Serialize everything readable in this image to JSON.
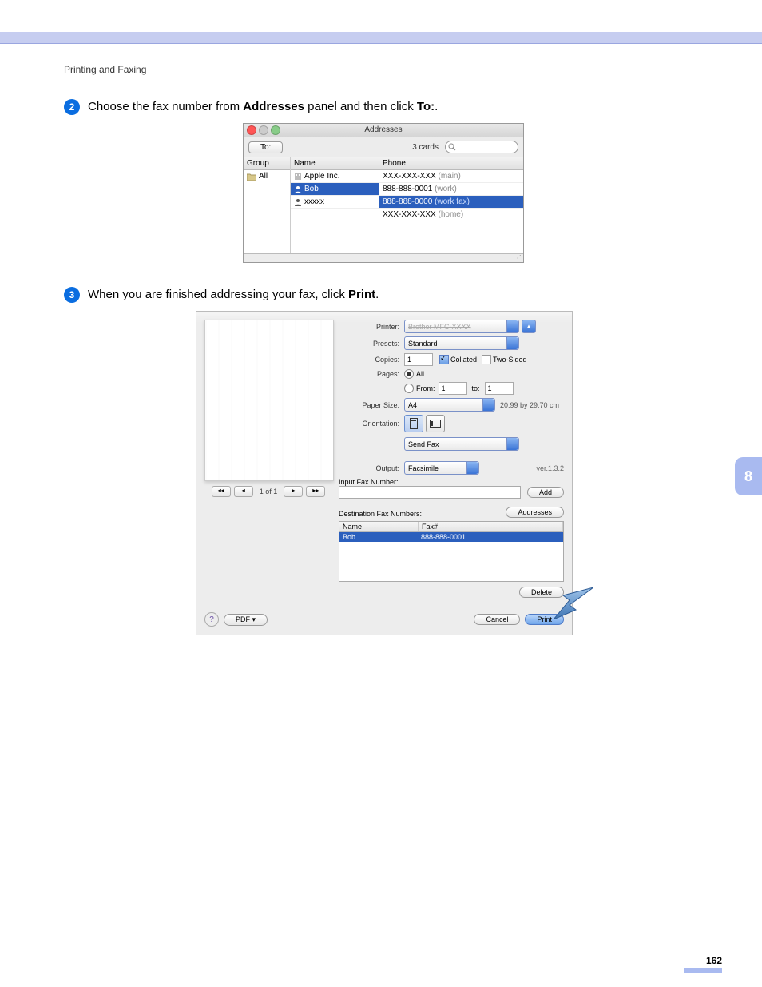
{
  "doc": {
    "header": "Printing and Faxing",
    "chapter_tab": "8",
    "page_number": "162"
  },
  "steps": {
    "s2": {
      "num": "2",
      "pre": "Choose the fax number from ",
      "b1": "Addresses",
      "mid": " panel and then click ",
      "b2": "To:",
      "post": "."
    },
    "s3": {
      "num": "3",
      "pre": "When you are finished addressing your fax, click ",
      "b1": "Print",
      "post": "."
    }
  },
  "addresses_panel": {
    "title": "Addresses",
    "to_button": "To:",
    "card_count": "3 cards",
    "search_placeholder": "",
    "columns": {
      "group": "Group",
      "name": "Name",
      "phone": "Phone"
    },
    "group_items": [
      "All"
    ],
    "contacts": [
      {
        "name": "Apple Inc.",
        "phones": [
          {
            "number": "XXX-XXX-XXX",
            "label": "(main)",
            "selected": false
          }
        ]
      },
      {
        "name": "Bob",
        "selected": true,
        "phones": [
          {
            "number": "888-888-0001",
            "label": "(work)",
            "selected": false
          },
          {
            "number": "888-888-0000",
            "label": "(work fax)",
            "selected": true
          }
        ]
      },
      {
        "name": "xxxxx",
        "phones": [
          {
            "number": "XXX-XXX-XXX",
            "label": "(home)",
            "selected": false
          }
        ]
      }
    ]
  },
  "print_dialog": {
    "pager": {
      "of_text": "1 of 1"
    },
    "labels": {
      "printer": "Printer:",
      "presets": "Presets:",
      "copies": "Copies:",
      "pages": "Pages:",
      "from": "From:",
      "to": "to:",
      "paper_size": "Paper Size:",
      "orientation": "Orientation:",
      "output": "Output:",
      "input_fax": "Input Fax Number:",
      "dest_fax": "Destination Fax Numbers:"
    },
    "values": {
      "printer": "Brother MFC-XXXX",
      "presets": "Standard",
      "copies": "1",
      "collated_label": "Collated",
      "collated_checked": true,
      "twosided_label": "Two-Sided",
      "twosided_checked": false,
      "pages_all": "All",
      "pages_all_checked": true,
      "page_from": "1",
      "page_to": "1",
      "paper_size": "A4",
      "paper_dims": "20.99 by 29.70 cm",
      "panel": "Send Fax",
      "output": "Facsimile",
      "version": "ver.1.3.2",
      "input_fax_value": ""
    },
    "buttons": {
      "add": "Add",
      "addresses": "Addresses",
      "delete": "Delete",
      "pdf": "PDF ▾",
      "cancel": "Cancel",
      "print": "Print"
    },
    "dest_table": {
      "col_name": "Name",
      "col_fax": "Fax#",
      "rows": [
        {
          "name": "Bob",
          "fax": "888-888-0001"
        }
      ]
    }
  }
}
